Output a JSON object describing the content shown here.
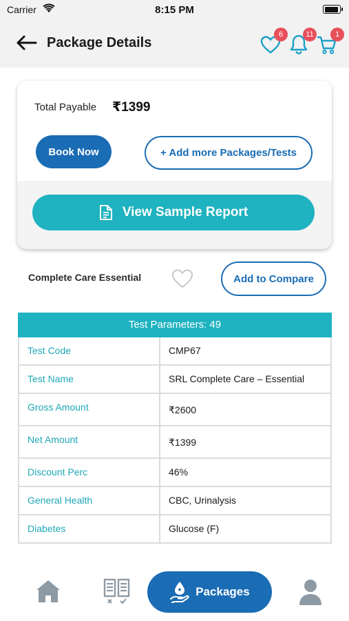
{
  "status_bar": {
    "carrier": "Carrier",
    "time": "8:15 PM"
  },
  "header": {
    "title": "Package Details",
    "wishlist_count": "6",
    "notifications_count": "11",
    "cart_count": "1"
  },
  "summary": {
    "total_label": "Total Payable",
    "total_amount": "₹1399",
    "book_now_label": "Book Now",
    "add_more_label": "+ Add more Packages/Tests",
    "sample_report_label": "View Sample Report"
  },
  "package": {
    "name": "Complete Care Essential",
    "compare_label": "Add to Compare"
  },
  "table": {
    "header": "Test Parameters: 49",
    "rows": [
      {
        "key": "Test Code",
        "value": "CMP67"
      },
      {
        "key": "Test Name",
        "value": "SRL Complete Care – Essential"
      },
      {
        "key": "Gross Amount",
        "value": "₹2600"
      },
      {
        "key": "Net Amount",
        "value": "₹1399"
      },
      {
        "key": "Discount Perc",
        "value": "46%"
      },
      {
        "key": "General Health",
        "value": "CBC, Urinalysis"
      },
      {
        "key": "Diabetes",
        "value": "Glucose (F)"
      }
    ]
  },
  "bottom_nav": {
    "packages_label": "Packages"
  },
  "colors": {
    "primary_blue": "#1a6cb4",
    "teal": "#1fb2c0",
    "badge_red": "#e8505b",
    "icon_teal": "#1aa0c8"
  }
}
